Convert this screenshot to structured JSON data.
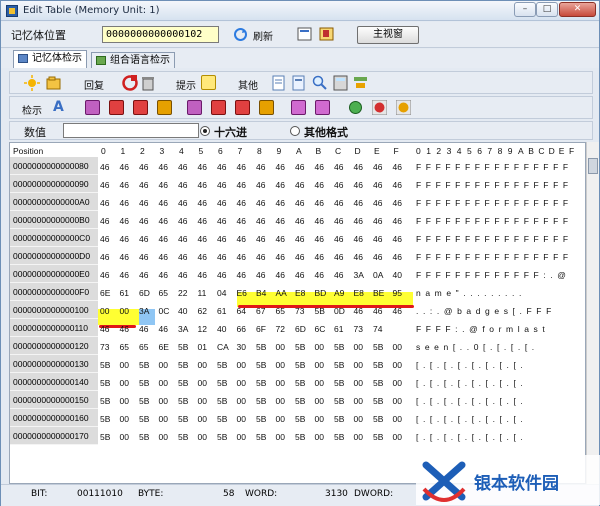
{
  "window": {
    "title": "Edit Table (Memory Unit: 1)",
    "min": "–",
    "max": "□",
    "close": "✕"
  },
  "toolbar1": {
    "addr_label": "记忆体位置",
    "addr_value": "0000000000000102",
    "refresh": "刷新",
    "main_window": "主视窗"
  },
  "tabs": [
    "记忆体检示",
    "组合语言检示"
  ],
  "toolbar2": {
    "restore": "回复",
    "hint": "提示",
    "other": "其他"
  },
  "toolbar3": {
    "view": "检示",
    "hex_badge": "HEX"
  },
  "toolbar4": {
    "value_label": "数值",
    "value_input": "",
    "hex": "十六进",
    "other_fmt": "其他格式"
  },
  "grid": {
    "header_pos": "Position",
    "col_hex": [
      "0",
      "1",
      "2",
      "3",
      "4",
      "5",
      "6",
      "7",
      "8",
      "9",
      "A",
      "B",
      "C",
      "D",
      "E",
      "F"
    ],
    "col_ascii": "0123456789ABCDEF",
    "rows": [
      {
        "addr": "0000000000000080",
        "hex": [
          "46",
          "46",
          "46",
          "46",
          "46",
          "46",
          "46",
          "46",
          "46",
          "46",
          "46",
          "46",
          "46",
          "46",
          "46",
          "46"
        ],
        "ascii": "FFFFFFFFFFFFFFFF"
      },
      {
        "addr": "0000000000000090",
        "hex": [
          "46",
          "46",
          "46",
          "46",
          "46",
          "46",
          "46",
          "46",
          "46",
          "46",
          "46",
          "46",
          "46",
          "46",
          "46",
          "46"
        ],
        "ascii": "FFFFFFFFFFFFFFFF"
      },
      {
        "addr": "00000000000000A0",
        "hex": [
          "46",
          "46",
          "46",
          "46",
          "46",
          "46",
          "46",
          "46",
          "46",
          "46",
          "46",
          "46",
          "46",
          "46",
          "46",
          "46"
        ],
        "ascii": "FFFFFFFFFFFFFFFF"
      },
      {
        "addr": "00000000000000B0",
        "hex": [
          "46",
          "46",
          "46",
          "46",
          "46",
          "46",
          "46",
          "46",
          "46",
          "46",
          "46",
          "46",
          "46",
          "46",
          "46",
          "46"
        ],
        "ascii": "FFFFFFFFFFFFFFFF"
      },
      {
        "addr": "00000000000000C0",
        "hex": [
          "46",
          "46",
          "46",
          "46",
          "46",
          "46",
          "46",
          "46",
          "46",
          "46",
          "46",
          "46",
          "46",
          "46",
          "46",
          "46"
        ],
        "ascii": "FFFFFFFFFFFFFFFF"
      },
      {
        "addr": "00000000000000D0",
        "hex": [
          "46",
          "46",
          "46",
          "46",
          "46",
          "46",
          "46",
          "46",
          "46",
          "46",
          "46",
          "46",
          "46",
          "46",
          "46",
          "46"
        ],
        "ascii": "FFFFFFFFFFFFFFFF"
      },
      {
        "addr": "00000000000000E0",
        "hex": [
          "46",
          "46",
          "46",
          "46",
          "46",
          "46",
          "46",
          "46",
          "46",
          "46",
          "46",
          "46",
          "46",
          "3A",
          "0A",
          "40"
        ],
        "ascii": "FFFFFFFFFFFFF:.@"
      },
      {
        "addr": "00000000000000F0",
        "hex": [
          "6E",
          "61",
          "6D",
          "65",
          "22",
          "11",
          "04",
          "E6",
          "B4",
          "AA",
          "E8",
          "BD",
          "A9",
          "E8",
          "BE",
          "95"
        ],
        "ascii": "name\"........."
      },
      {
        "addr": "0000000000000100",
        "hex": [
          "00",
          "00",
          "3A",
          "0C",
          "40",
          "62",
          "61",
          "64",
          "67",
          "65",
          "73",
          "5B",
          "0D",
          "46",
          "46",
          "46"
        ],
        "ascii": "..:.@badges[.FFF"
      },
      {
        "addr": "0000000000000110",
        "hex": [
          "46",
          "46",
          "46",
          "46",
          "3A",
          "12",
          "40",
          "66",
          "6F",
          "72",
          "6D",
          "6C",
          "61",
          "73",
          "74"
        ],
        "ascii": "FFFF:.@formlast"
      },
      {
        "addr": "0000000000000120",
        "hex": [
          "73",
          "65",
          "65",
          "6E",
          "5B",
          "01",
          "CA",
          "30",
          "5B",
          "00",
          "5B",
          "00",
          "5B",
          "00",
          "5B",
          "00"
        ],
        "ascii": "seen[..0[.[.[.[."
      },
      {
        "addr": "0000000000000130",
        "hex": [
          "5B",
          "00",
          "5B",
          "00",
          "5B",
          "00",
          "5B",
          "00",
          "5B",
          "00",
          "5B",
          "00",
          "5B",
          "00",
          "5B",
          "00"
        ],
        "ascii": "[.[.[.[.[.[.[.[."
      },
      {
        "addr": "0000000000000140",
        "hex": [
          "5B",
          "00",
          "5B",
          "00",
          "5B",
          "00",
          "5B",
          "00",
          "5B",
          "00",
          "5B",
          "00",
          "5B",
          "00",
          "5B",
          "00"
        ],
        "ascii": "[.[.[.[.[.[.[.[."
      },
      {
        "addr": "0000000000000150",
        "hex": [
          "5B",
          "00",
          "5B",
          "00",
          "5B",
          "00",
          "5B",
          "00",
          "5B",
          "00",
          "5B",
          "00",
          "5B",
          "00",
          "5B",
          "00"
        ],
        "ascii": "[.[.[.[.[.[.[.[."
      },
      {
        "addr": "0000000000000160",
        "hex": [
          "5B",
          "00",
          "5B",
          "00",
          "5B",
          "00",
          "5B",
          "00",
          "5B",
          "00",
          "5B",
          "00",
          "5B",
          "00",
          "5B",
          "00"
        ],
        "ascii": "[.[.[.[.[.[.[.[."
      },
      {
        "addr": "0000000000000170",
        "hex": [
          "5B",
          "00",
          "5B",
          "00",
          "5B",
          "00",
          "5B",
          "00",
          "5B",
          "00",
          "5B",
          "00",
          "5B",
          "00",
          "5B",
          "00"
        ],
        "ascii": "[.[.[.[.[.[.[.[."
      }
    ]
  },
  "status": {
    "bit_label": "BIT:",
    "bit_value": "00111010",
    "byte_label": "BYTE:",
    "byte_value": "58",
    "word_label": "WORD:",
    "word_value": "3130",
    "dword_label": "DWORD:"
  },
  "watermark": {
    "text": "银本软件园"
  },
  "colors": {
    "highlight": "#ffff33",
    "selection": "#8fc6f4",
    "underline": "#e01818"
  }
}
